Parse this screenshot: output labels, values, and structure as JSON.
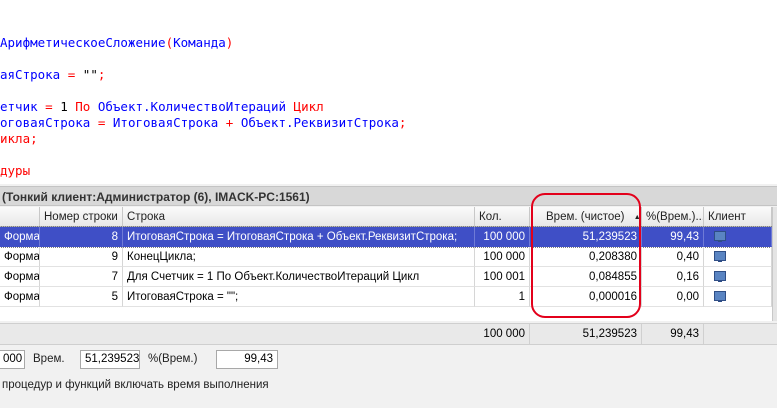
{
  "code": {
    "lines": [
      {
        "parts": [
          {
            "t": "Арифметическое",
            "c": "id"
          },
          {
            "t": "Сложение",
            "c": "id"
          },
          {
            "t": "(",
            "c": "sym"
          },
          {
            "t": "Команда",
            "c": "id"
          },
          {
            "t": ")",
            "c": "sym"
          }
        ]
      },
      {
        "parts": [
          {
            "t": "аяСтрока",
            "c": "id"
          },
          {
            "t": " = ",
            "c": "sym"
          },
          {
            "t": "\"\"",
            "c": "str"
          },
          {
            "t": ";",
            "c": "sym"
          }
        ]
      },
      {
        "parts": [
          {
            "t": "етчик",
            "c": "id"
          },
          {
            "t": " = ",
            "c": "sym"
          },
          {
            "t": "1",
            "c": "str"
          },
          {
            "t": " По ",
            "c": "kw"
          },
          {
            "t": "Объект.КоличествоИтераций",
            "c": "id"
          },
          {
            "t": " Цикл",
            "c": "kw"
          }
        ]
      },
      {
        "parts": [
          {
            "t": "оговаяСтрока",
            "c": "id"
          },
          {
            "t": " = ",
            "c": "sym"
          },
          {
            "t": "ИтоговаяСтрока",
            "c": "id"
          },
          {
            "t": " + ",
            "c": "sym"
          },
          {
            "t": "Объект.РеквизитСтрока",
            "c": "id"
          },
          {
            "t": ";",
            "c": "sym"
          }
        ]
      },
      {
        "parts": [
          {
            "t": "икла",
            "c": "kw"
          },
          {
            "t": ";",
            "c": "sym"
          }
        ]
      },
      {
        "parts": [
          {
            "t": "дуры",
            "c": "kw"
          }
        ]
      }
    ]
  },
  "panel": {
    "title": "(Тонкий клиент:Администратор (6), IMACK-PC:1561)"
  },
  "table": {
    "headers": {
      "module": "",
      "line_no": "Номер строки",
      "line": "Строка",
      "count": "Кол.",
      "time": "Врем. (чистое)",
      "sort_icon": "▲",
      "pct": "%(Врем.)...",
      "client": "Клиент"
    },
    "rows": [
      {
        "module": "Форма",
        "line_no": "8",
        "line": "ИтоговаяСтрока = ИтоговаяСтрока + Объект.РеквизитСтрока;",
        "count": "100 000",
        "time": "51,239523",
        "pct": "99,43",
        "selected": true
      },
      {
        "module": "Форма",
        "line_no": "9",
        "line": "КонецЦикла;",
        "count": "100 000",
        "time": "0,208380",
        "pct": "0,40",
        "selected": false
      },
      {
        "module": "Форма",
        "line_no": "7",
        "line": "Для Счетчик = 1 По Объект.КоличествоИтераций Цикл",
        "count": "100 001",
        "time": "0,084855",
        "pct": "0,16",
        "selected": false
      },
      {
        "module": "Форма",
        "line_no": "5",
        "line": "ИтоговаяСтрока = \"\";",
        "count": "1",
        "time": "0,000016",
        "pct": "0,00",
        "selected": false
      }
    ],
    "totals": {
      "count": "100 000",
      "time": "51,239523",
      "pct": "99,43"
    }
  },
  "footer": {
    "count_value": "000",
    "time_label": "Врем.",
    "time_value": "51,239523",
    "pct_label": "%(Врем.)",
    "pct_value": "99,43",
    "note": "процедур и функций включать время выполнения"
  },
  "colors": {
    "selection": "#3f4fc6",
    "highlight": "#e3001b",
    "keyword": "#ff0000",
    "identifier": "#0000ff"
  },
  "icons": {
    "client": "monitor-icon",
    "sort": "sort-ascending-icon"
  }
}
